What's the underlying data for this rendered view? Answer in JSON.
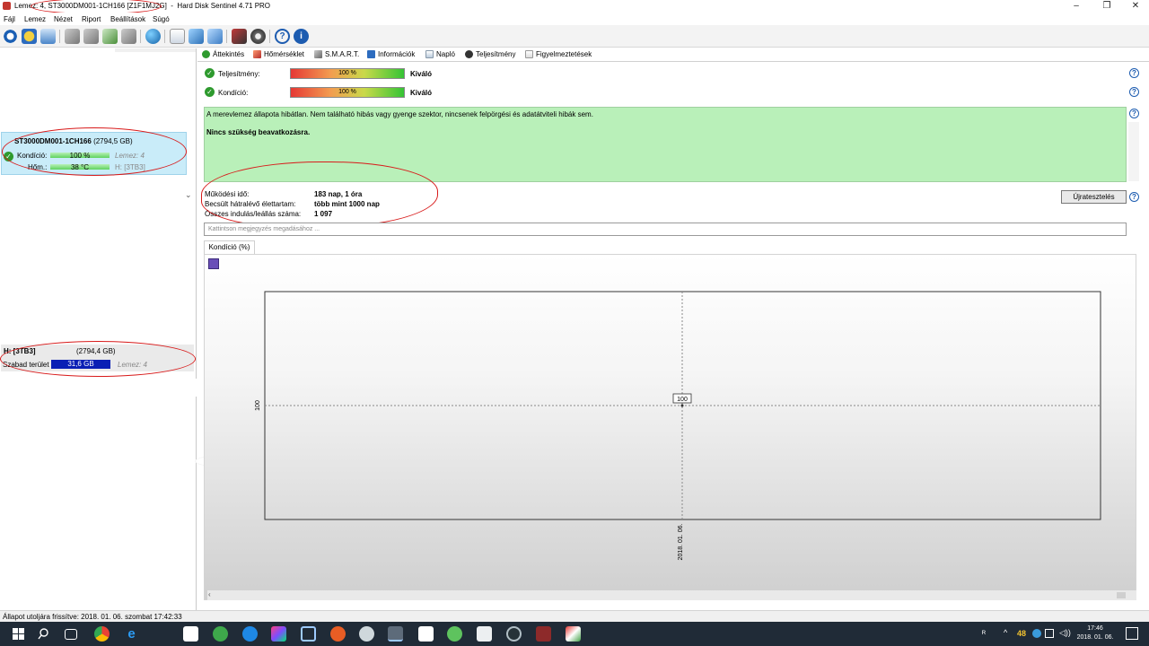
{
  "window": {
    "title_prefix": "Lemez: 4, ST3000DM001-1CH166 [Z1F1MJ2G]",
    "app_name": "Hard Disk Sentinel 4.71 PRO",
    "minimize": "–",
    "restore": "❐",
    "close": "✕"
  },
  "menu": [
    "Fájl",
    "Lemez",
    "Nézet",
    "Riport",
    "Beállítások",
    "Súgó"
  ],
  "left_panel": {
    "disk": {
      "name": "ST3000DM001-1CH166",
      "size": "(2794,5 GB)",
      "condition_label": "Kondíció:",
      "condition_value": "100 %",
      "condition_pct": 100,
      "disk_label": "Lemez: 4",
      "temp_label": "Hőm.:",
      "temp_value": "38 °C",
      "volume_ref": "H: [3TB3]"
    },
    "volume": {
      "name": "H: [3TB3]",
      "size": "(2794,4 GB)",
      "free_label": "Szabad terület",
      "free_value": "31,6 GB",
      "disk_label": "Lemez: 4"
    }
  },
  "tabs": [
    "Áttekintés",
    "Hőmérséklet",
    "S.M.A.R.T.",
    "Információk",
    "Napló",
    "Teljesítmény",
    "Figyelmeztetések"
  ],
  "overview": {
    "performance_label": "Teljesítmény:",
    "performance_value": "100 %",
    "performance_pct": 100,
    "performance_rating": "Kiváló",
    "condition_label": "Kondíció:",
    "condition_value": "100 %",
    "condition_pct": 100,
    "condition_rating": "Kiváló",
    "message": "A merevlemez állapota hibátlan. Nem található hibás vagy gyenge szektor, nincsenek felpörgési és adatátviteli hibák sem.",
    "action": "Nincs szükség beavatkozásra.",
    "stats": [
      {
        "label": "Működési idő:",
        "value": "183 nap, 1 óra"
      },
      {
        "label": "Becsült hátralévő élettartam:",
        "value": "több mint 1000 nap"
      },
      {
        "label": "Összes indulás/leállás száma:",
        "value": "1 097"
      }
    ],
    "retest_button": "Újratesztelés",
    "note_placeholder": "Kattintson megjegyzés megadásához ..."
  },
  "chart_tab": "Kondíció  (%)",
  "chart_data": {
    "type": "line",
    "x": [
      "2018. 01. 06."
    ],
    "series": [
      {
        "values": [
          100
        ]
      }
    ],
    "y_tick": "100",
    "data_label": "100",
    "grid": true
  },
  "statusbar": "Állapot utoljára frissítve: 2018. 01. 06. szombat 17:42:33",
  "taskbar": {
    "tray_number": "48",
    "time": "17:46",
    "date": "2018. 01. 06."
  },
  "colors": {
    "accent_green": "#b9f0b9",
    "selection": "#c9ecf9",
    "volume_bar": "#0a1fb5",
    "annotation_red": "#d81b1b"
  }
}
